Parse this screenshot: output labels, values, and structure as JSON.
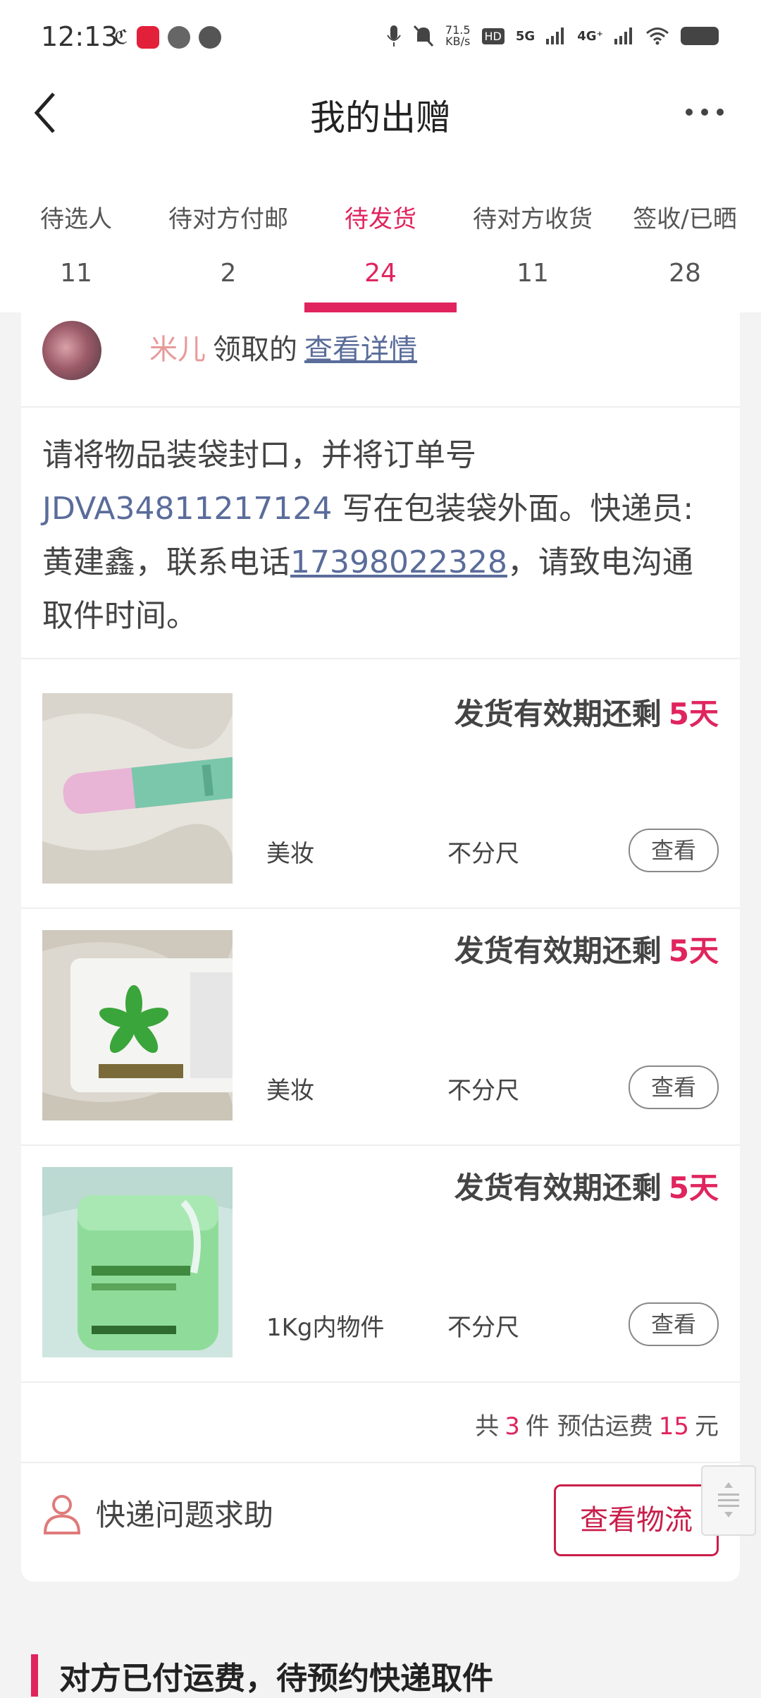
{
  "status_bar": {
    "time": "12:13",
    "speed_value": "71.5",
    "speed_unit": "KB/s",
    "net1": "5G",
    "net2": "4G⁺",
    "hd": "HD"
  },
  "header": {
    "title": "我的出赠"
  },
  "tabs": [
    {
      "label": "待选人",
      "count": "11"
    },
    {
      "label": "待对方付邮",
      "count": "2"
    },
    {
      "label": "待发货",
      "count": "24",
      "active": true
    },
    {
      "label": "待对方收货",
      "count": "11"
    },
    {
      "label": "签收/已晒",
      "count": "28"
    }
  ],
  "receiver": {
    "name": "米儿",
    "suffix": "领取的",
    "link": "查看详情"
  },
  "note": {
    "part1": "请将物品装袋封口，并将订单号 ",
    "order_no": "JDVA34811217124",
    "part2": " 写在包装袋外面。快递员:黄建鑫，联系电话",
    "phone": "17398022328",
    "part3": "，请致电沟通取件时间。"
  },
  "items": [
    {
      "deadline": "发货有效期还剩",
      "days": "5天",
      "category": "美妆",
      "size": "不分尺",
      "button": "查看"
    },
    {
      "deadline": "发货有效期还剩",
      "days": "5天",
      "category": "美妆",
      "size": "不分尺",
      "button": "查看"
    },
    {
      "deadline": "发货有效期还剩",
      "days": "5天",
      "category": "1Kg内物件",
      "size": "不分尺",
      "button": "查看"
    }
  ],
  "summary": {
    "prefix": "共",
    "count": "3",
    "mid": "件 预估运费",
    "fee": "15",
    "unit": "元"
  },
  "help": {
    "label": "快递问题求助",
    "logistics_button": "查看物流"
  },
  "section2": {
    "title": "对方已付运费，待预约快递取件"
  },
  "colors": {
    "accent": "#e0245e",
    "link": "#5a6c9a",
    "name": "#e89a9a"
  }
}
